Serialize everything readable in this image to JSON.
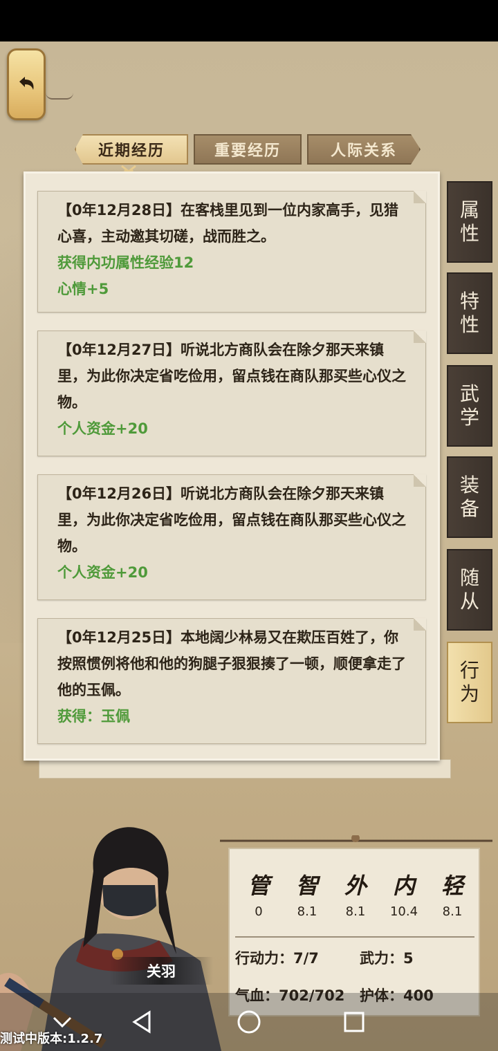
{
  "tabs": [
    {
      "label": "近期经历",
      "active": true
    },
    {
      "label": "重要经历",
      "active": false
    },
    {
      "label": "人际关系",
      "active": false
    }
  ],
  "logs": [
    {
      "text": "【0年12月28日】在客栈里见到一位内家高手，见猎心喜，主动邀其切磋，战而胜之。",
      "effects": [
        "获得内功属性经验12",
        "心情+5"
      ]
    },
    {
      "text": "【0年12月27日】听说北方商队会在除夕那天来镇里，为此你决定省吃俭用，留点钱在商队那买些心仪之物。",
      "effects": [
        "个人资金+20"
      ]
    },
    {
      "text": "【0年12月26日】听说北方商队会在除夕那天来镇里，为此你决定省吃俭用，留点钱在商队那买些心仪之物。",
      "effects": [
        "个人资金+20"
      ]
    },
    {
      "text": "【0年12月25日】本地阔少林易又在欺压百姓了，你按照惯例将他和他的狗腿子狠狠揍了一顿，顺便拿走了他的玉佩。",
      "effects": [
        "获得：玉佩"
      ]
    }
  ],
  "side_tabs": [
    {
      "label": "属性",
      "active": false
    },
    {
      "label": "特性",
      "active": false
    },
    {
      "label": "武学",
      "active": false
    },
    {
      "label": "装备",
      "active": false
    },
    {
      "label": "随从",
      "active": false
    },
    {
      "label": "行为",
      "active": true
    }
  ],
  "character": {
    "name": "关羽"
  },
  "stats": {
    "heads": [
      "管",
      "智",
      "外",
      "内",
      "轻"
    ],
    "values": [
      "0",
      "8.1",
      "8.1",
      "10.4",
      "8.1"
    ],
    "action_power": "行动力：7/7",
    "martial_power": "武力：5",
    "hp": "气血：702/702",
    "protect": "护体：400"
  },
  "version": "测试中版本:1.2.7",
  "colors": {
    "effect_green": "#4f9a3a",
    "active_tab": "#e2c78f",
    "side_tab_dark": "#3b322b"
  },
  "icons": [
    "back-arrow-icon",
    "nav-back-icon",
    "nav-home-icon",
    "nav-recent-icon",
    "nav-chevron-down-icon"
  ]
}
